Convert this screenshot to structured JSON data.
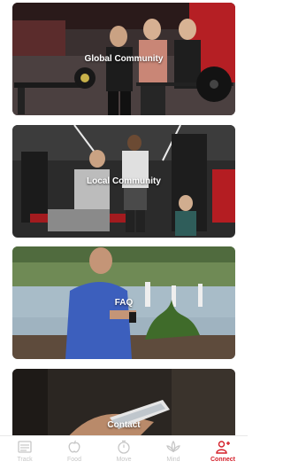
{
  "cards": [
    {
      "label": "Global Community"
    },
    {
      "label": "Local Community"
    },
    {
      "label": "FAQ"
    },
    {
      "label": "Contact"
    }
  ],
  "tabs": [
    {
      "label": "Track",
      "icon": "track-icon",
      "active": false
    },
    {
      "label": "Food",
      "icon": "food-icon",
      "active": false
    },
    {
      "label": "Move",
      "icon": "move-icon",
      "active": false
    },
    {
      "label": "Mind",
      "icon": "mind-icon",
      "active": false
    },
    {
      "label": "Connect",
      "icon": "connect-icon",
      "active": true
    }
  ],
  "colors": {
    "accent": "#d4202a",
    "inactive": "#c6c6c6"
  }
}
